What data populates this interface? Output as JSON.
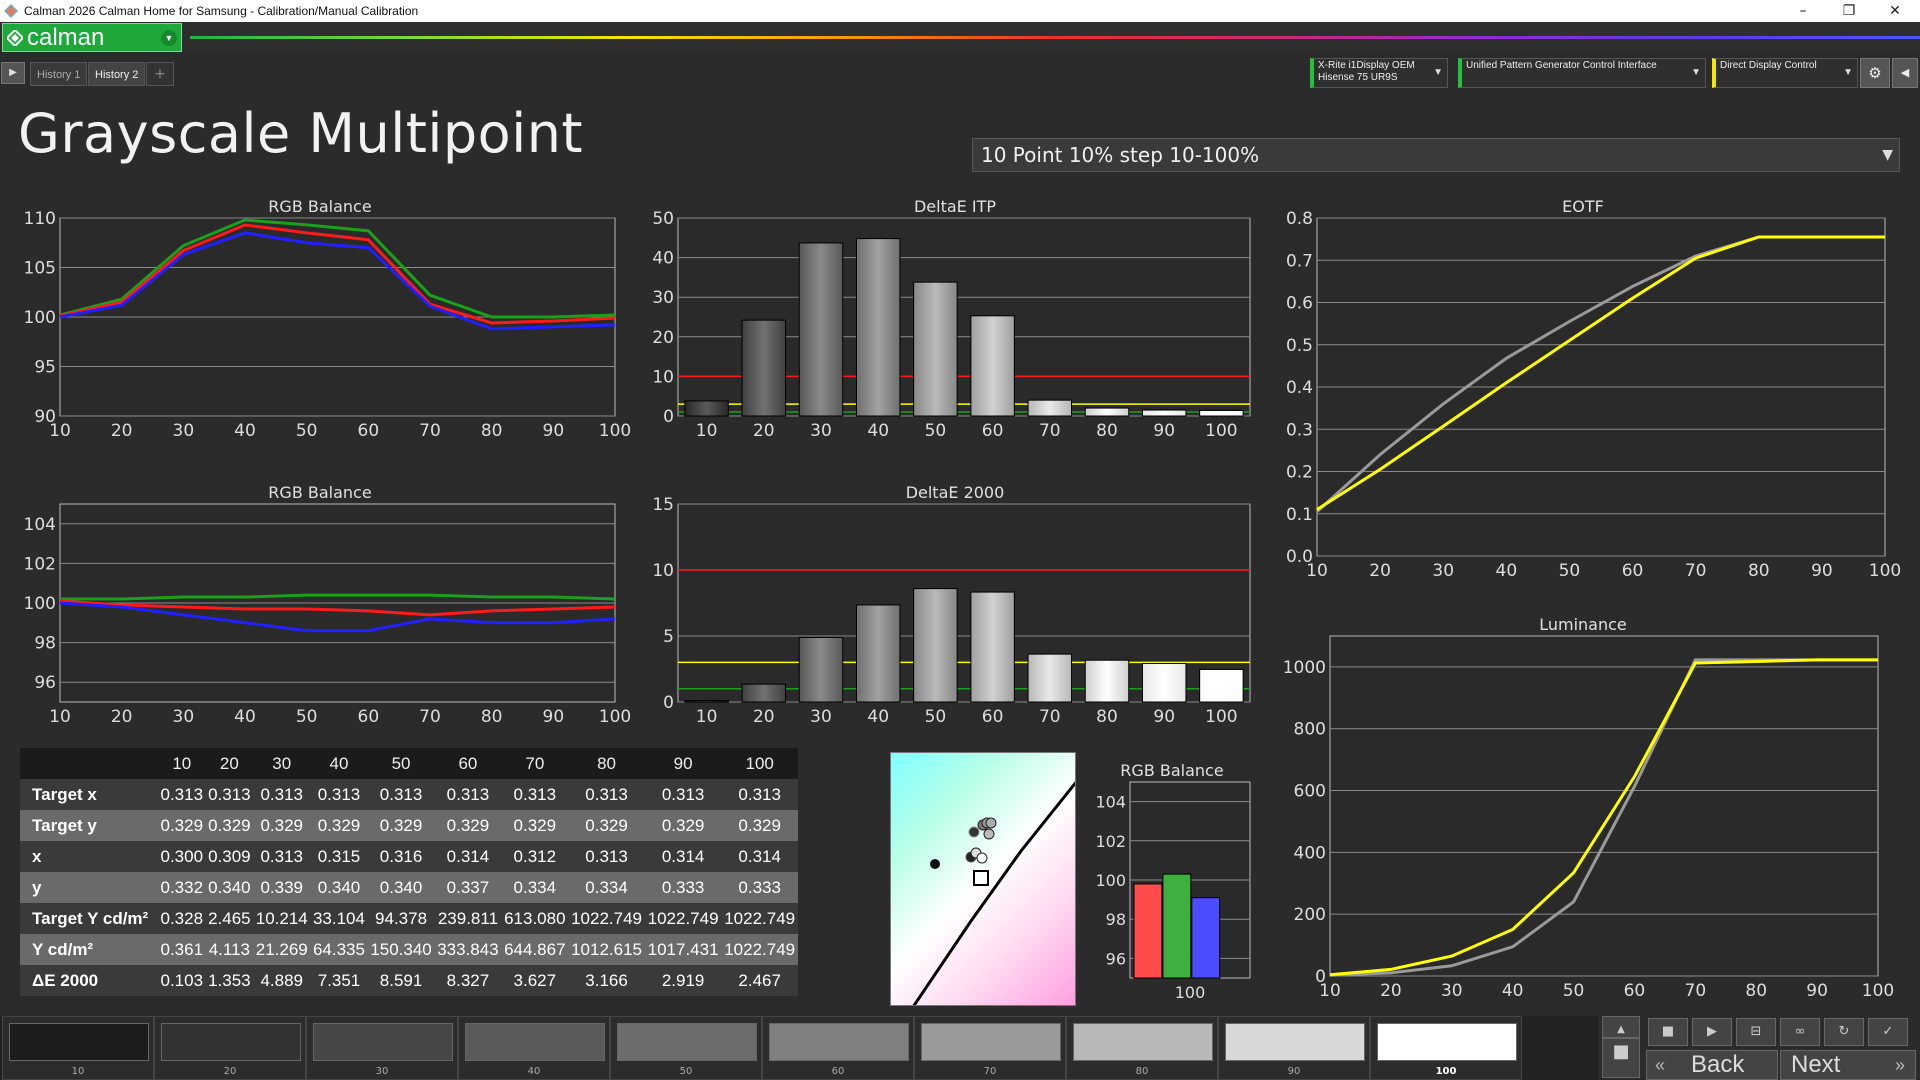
{
  "window": {
    "title": "Calman 2026 Calman Home for Samsung  - Calibration/Manual Calibration",
    "min": "–",
    "max": "❐",
    "close": "✕"
  },
  "brand": {
    "name": "calman",
    "menu_icon": "chevron-down-icon"
  },
  "tabs": [
    {
      "label": "History 1"
    },
    {
      "label": "History 2"
    }
  ],
  "tab_add": "+",
  "devices": [
    {
      "line1": "X-Rite i1Display OEM",
      "line2": "Hisense 75 UR9S",
      "accent": "#22c33b"
    },
    {
      "line1": "Unified Pattern Generator Control Interface",
      "line2": "",
      "accent": "#22c33b"
    },
    {
      "line1": "Direct Display Control",
      "line2": "",
      "accent": "#f3e600"
    }
  ],
  "page_title": "Grayscale Multipoint",
  "workflow_select": {
    "value": "10 Point 10% step 10-100%"
  },
  "colors": {
    "red": "#ff1a1a",
    "green": "#1aa01a",
    "blue": "#2020ff",
    "yellow": "#ffff00",
    "gray": "#9a9a9a"
  },
  "chart_data": [
    {
      "type": "line",
      "title": "RGB Balance",
      "x": [
        10,
        20,
        30,
        40,
        50,
        60,
        70,
        80,
        90,
        100
      ],
      "ylim": [
        90,
        110
      ],
      "yticks": [
        90,
        95,
        100,
        105,
        110
      ],
      "series": [
        {
          "color": "#1aa01a",
          "values": [
            100.2,
            101.8,
            107.2,
            109.8,
            109.3,
            108.7,
            102.2,
            100.0,
            100.0,
            100.2
          ]
        },
        {
          "color": "#ff1a1a",
          "values": [
            100.1,
            101.5,
            106.7,
            109.3,
            108.5,
            107.8,
            101.3,
            99.4,
            99.6,
            99.9
          ]
        },
        {
          "color": "#2020ff",
          "values": [
            100.0,
            101.2,
            106.3,
            108.5,
            107.5,
            107.0,
            101.1,
            98.8,
            99.0,
            99.2
          ]
        }
      ]
    },
    {
      "type": "bar",
      "title": "DeltaE ITP",
      "categories": [
        "10",
        "20",
        "30",
        "40",
        "50",
        "60",
        "70",
        "80",
        "90",
        "100"
      ],
      "values": [
        3.8,
        24.2,
        43.7,
        44.8,
        33.8,
        25.3,
        4.0,
        2.0,
        1.5,
        1.4
      ],
      "ylim": [
        0,
        50
      ],
      "yticks": [
        0,
        10,
        20,
        30,
        40,
        50
      ],
      "thresholds": [
        {
          "value": 10,
          "color": "#ff1a1a"
        },
        {
          "value": 3,
          "color": "#ffff00"
        },
        {
          "value": 1,
          "color": "#1aa01a"
        }
      ]
    },
    {
      "type": "line",
      "title": "EOTF",
      "x": [
        10,
        20,
        30,
        40,
        50,
        60,
        70,
        80,
        90,
        100
      ],
      "ylim": [
        0,
        0.8
      ],
      "yticks": [
        0,
        0.1,
        0.2,
        0.3,
        0.4,
        0.5,
        0.6,
        0.7,
        0.8
      ],
      "series": [
        {
          "color": "#9a9a9a",
          "values": [
            0.105,
            0.24,
            0.36,
            0.468,
            0.555,
            0.638,
            0.71,
            0.755,
            0.755,
            0.755
          ]
        },
        {
          "color": "#ffff00",
          "values": [
            0.11,
            0.205,
            0.307,
            0.41,
            0.51,
            0.61,
            0.705,
            0.755,
            0.755,
            0.755
          ]
        }
      ]
    },
    {
      "type": "line",
      "title": "RGB Balance",
      "x": [
        10,
        20,
        30,
        40,
        50,
        60,
        70,
        80,
        90,
        100
      ],
      "ylim": [
        95,
        105
      ],
      "yticks": [
        96,
        98,
        100,
        102,
        104
      ],
      "series": [
        {
          "color": "#1aa01a",
          "values": [
            100.2,
            100.2,
            100.3,
            100.3,
            100.4,
            100.4,
            100.4,
            100.3,
            100.3,
            100.2
          ]
        },
        {
          "color": "#ff1a1a",
          "values": [
            100.1,
            99.9,
            99.8,
            99.7,
            99.7,
            99.6,
            99.4,
            99.6,
            99.7,
            99.8
          ]
        },
        {
          "color": "#2020ff",
          "values": [
            100.0,
            99.8,
            99.4,
            99.0,
            98.6,
            98.6,
            99.2,
            99.0,
            99.0,
            99.2
          ]
        }
      ]
    },
    {
      "type": "bar",
      "title": "DeltaE 2000",
      "categories": [
        "10",
        "20",
        "30",
        "40",
        "50",
        "60",
        "70",
        "80",
        "90",
        "100"
      ],
      "values": [
        0.103,
        1.353,
        4.889,
        7.351,
        8.591,
        8.327,
        3.627,
        3.166,
        2.919,
        2.467
      ],
      "ylim": [
        0,
        15
      ],
      "yticks": [
        0,
        5,
        10,
        15
      ],
      "thresholds": [
        {
          "value": 10,
          "color": "#ff1a1a"
        },
        {
          "value": 3,
          "color": "#ffff00"
        },
        {
          "value": 1,
          "color": "#1aa01a"
        }
      ]
    },
    {
      "type": "line",
      "title": "Luminance",
      "x": [
        10,
        20,
        30,
        40,
        50,
        60,
        70,
        80,
        90,
        100
      ],
      "ylim": [
        0,
        1100
      ],
      "yticks": [
        0,
        200,
        400,
        600,
        800,
        1000
      ],
      "series": [
        {
          "color": "#9a9a9a",
          "values": [
            2.465,
            10.214,
            33.104,
            94.378,
            239.811,
            613.08,
            1022.749,
            1022.749,
            1022.749,
            1022.749
          ]
        },
        {
          "color": "#ffff00",
          "values": [
            4.113,
            21.269,
            64.335,
            150.34,
            333.843,
            644.867,
            1012.615,
            1017.431,
            1022.749,
            1022.749
          ]
        }
      ]
    },
    {
      "type": "bar",
      "title": "RGB Balance",
      "categories": [
        "100"
      ],
      "series": [
        {
          "color": "#ff4b4b",
          "values": [
            99.8
          ]
        },
        {
          "color": "#3faf3f",
          "values": [
            100.3
          ]
        },
        {
          "color": "#4b4bff",
          "values": [
            99.1
          ]
        }
      ],
      "ylim": [
        95,
        105
      ],
      "yticks": [
        96,
        98,
        100,
        102,
        104
      ]
    }
  ],
  "table": {
    "columns": [
      "10",
      "20",
      "30",
      "40",
      "50",
      "60",
      "70",
      "80",
      "90",
      "100"
    ],
    "rows": [
      {
        "label": "Target x",
        "values": [
          "0.313",
          "0.313",
          "0.313",
          "0.313",
          "0.313",
          "0.313",
          "0.313",
          "0.313",
          "0.313",
          "0.313"
        ]
      },
      {
        "label": "Target y",
        "values": [
          "0.329",
          "0.329",
          "0.329",
          "0.329",
          "0.329",
          "0.329",
          "0.329",
          "0.329",
          "0.329",
          "0.329"
        ]
      },
      {
        "label": "x",
        "values": [
          "0.300",
          "0.309",
          "0.313",
          "0.315",
          "0.316",
          "0.314",
          "0.312",
          "0.313",
          "0.314",
          "0.314"
        ]
      },
      {
        "label": "y",
        "values": [
          "0.332",
          "0.340",
          "0.339",
          "0.340",
          "0.340",
          "0.337",
          "0.334",
          "0.334",
          "0.333",
          "0.333"
        ]
      },
      {
        "label": "Target Y cd/m²",
        "values": [
          "0.328",
          "2.465",
          "10.214",
          "33.104",
          "94.378",
          "239.811",
          "613.080",
          "1022.749",
          "1022.749",
          "1022.749"
        ]
      },
      {
        "label": "Y cd/m²",
        "values": [
          "0.361",
          "4.113",
          "21.269",
          "64.335",
          "150.340",
          "333.843",
          "644.867",
          "1012.615",
          "1017.431",
          "1022.749"
        ]
      },
      {
        "label": "ΔE 2000",
        "values": [
          "0.103",
          "1.353",
          "4.889",
          "7.351",
          "8.591",
          "8.327",
          "3.627",
          "3.166",
          "2.919",
          "2.467"
        ]
      }
    ]
  },
  "patches": [
    {
      "label": "10",
      "color": "#1c1c1c"
    },
    {
      "label": "20",
      "color": "#333333"
    },
    {
      "label": "30",
      "color": "#474747"
    },
    {
      "label": "40",
      "color": "#5a5a5a"
    },
    {
      "label": "50",
      "color": "#6c6c6c"
    },
    {
      "label": "60",
      "color": "#808080"
    },
    {
      "label": "70",
      "color": "#9a9a9a"
    },
    {
      "label": "80",
      "color": "#b8b8b8"
    },
    {
      "label": "90",
      "color": "#d8d8d8"
    },
    {
      "label": "100",
      "color": "#ffffff"
    }
  ],
  "current_patch": "100",
  "nav": {
    "back": "Back",
    "next": "Next"
  },
  "control_icons": [
    "stop-icon",
    "play-icon",
    "measure-icon",
    "loop-icon",
    "refresh-icon",
    "check-icon"
  ]
}
